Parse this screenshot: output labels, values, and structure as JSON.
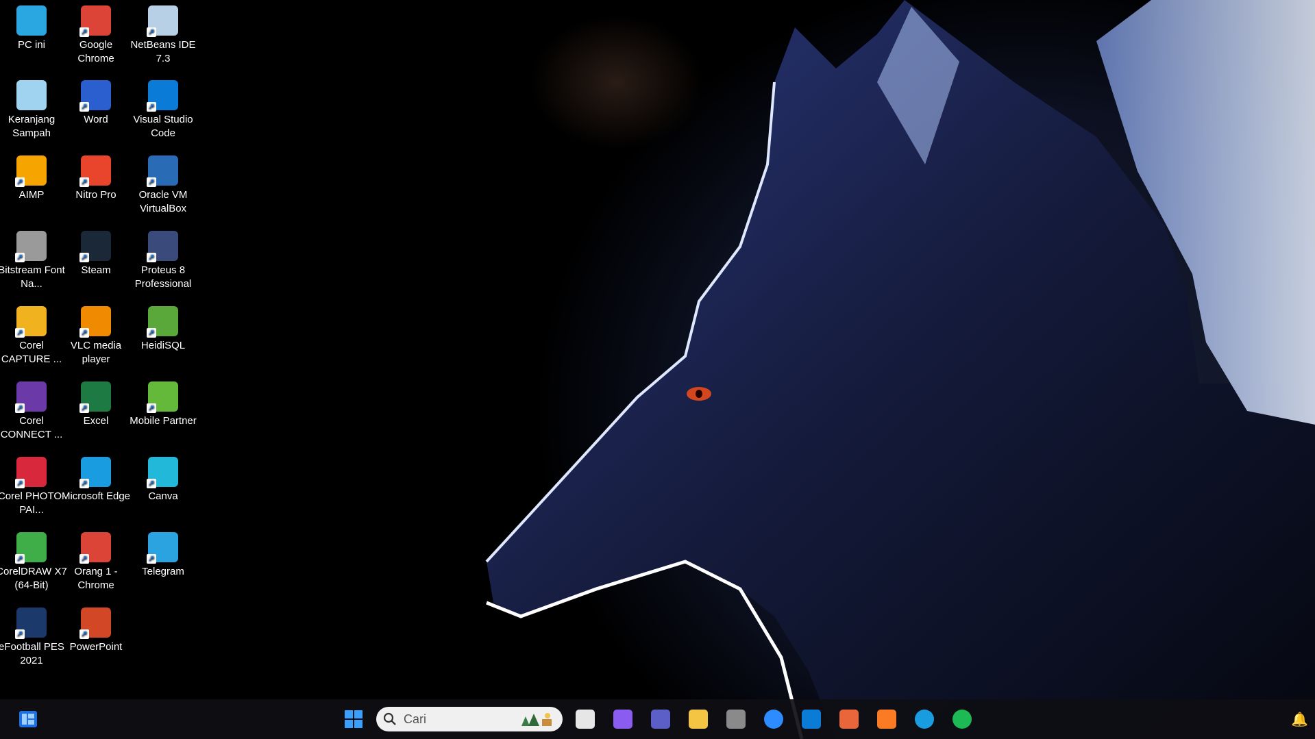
{
  "desktop": {
    "icons": [
      {
        "label": "PC ini",
        "icon": "monitor-icon",
        "color": "#2aa7e0"
      },
      {
        "label": "Keranjang Sampah",
        "icon": "recycle-bin-icon",
        "color": "#9fd3f0"
      },
      {
        "label": "AIMP",
        "icon": "aimp-icon",
        "color": "#f5a400"
      },
      {
        "label": "Bitstream Font Na...",
        "icon": "bitstream-font-icon",
        "color": "#9a9a9a"
      },
      {
        "label": "Corel CAPTURE ...",
        "icon": "corel-capture-icon",
        "color": "#f0b21e"
      },
      {
        "label": "Corel CONNECT ...",
        "icon": "corel-connect-icon",
        "color": "#6b3aa8"
      },
      {
        "label": "Corel PHOTO-PAI...",
        "icon": "corel-photopaint-icon",
        "color": "#d8283c"
      },
      {
        "label": "CorelDRAW X7 (64-Bit)",
        "icon": "coreldraw-icon",
        "color": "#3fae49"
      },
      {
        "label": "eFootball PES 2021",
        "icon": "efootball-icon",
        "color": "#1b3a6b"
      },
      {
        "label": "Google Chrome",
        "icon": "chrome-icon",
        "color": "#db4437"
      },
      {
        "label": "Word",
        "icon": "word-icon",
        "color": "#2b5fcf"
      },
      {
        "label": "Nitro Pro",
        "icon": "nitro-pro-icon",
        "color": "#e8452c"
      },
      {
        "label": "Steam",
        "icon": "steam-icon",
        "color": "#1b2838"
      },
      {
        "label": "VLC media player",
        "icon": "vlc-icon",
        "color": "#f08a00"
      },
      {
        "label": "Excel",
        "icon": "excel-icon",
        "color": "#1d7a43"
      },
      {
        "label": "Microsoft Edge",
        "icon": "edge-icon",
        "color": "#1a9de0"
      },
      {
        "label": "Orang 1 - Chrome",
        "icon": "chrome-profile-icon",
        "color": "#db4437"
      },
      {
        "label": "PowerPoint",
        "icon": "powerpoint-icon",
        "color": "#d24726"
      },
      {
        "label": "NetBeans IDE 7.3",
        "icon": "netbeans-icon",
        "color": "#b8d0e6"
      },
      {
        "label": "Visual Studio Code",
        "icon": "vscode-icon",
        "color": "#0a7bd6"
      },
      {
        "label": "Oracle VM VirtualBox",
        "icon": "virtualbox-icon",
        "color": "#2a6bb5"
      },
      {
        "label": "Proteus 8 Professional",
        "icon": "proteus-icon",
        "color": "#3a4a7a"
      },
      {
        "label": "HeidiSQL",
        "icon": "heidisql-icon",
        "color": "#5aa83a"
      },
      {
        "label": "Mobile Partner",
        "icon": "mobile-partner-icon",
        "color": "#64b83a"
      },
      {
        "label": "Canva",
        "icon": "canva-icon",
        "color": "#21b8d9"
      },
      {
        "label": "Telegram",
        "icon": "telegram-icon",
        "color": "#2aa3e0"
      }
    ]
  },
  "taskbar": {
    "widgets_icon": "widgets-icon",
    "start_icon": "windows-start-icon",
    "search": {
      "placeholder": "Cari",
      "icon": "search-icon",
      "highlight": "search-highlight-icon"
    },
    "pinned": [
      {
        "name": "task-view",
        "icon": "task-view-icon",
        "color": "#e6e6e6"
      },
      {
        "name": "copilot",
        "icon": "copilot-icon",
        "color": "#8a5cf0"
      },
      {
        "name": "teams",
        "icon": "teams-icon",
        "color": "#5b5fc7"
      },
      {
        "name": "file-explorer",
        "icon": "folder-icon",
        "color": "#f4c542"
      },
      {
        "name": "app-shield",
        "icon": "shield-app-icon",
        "color": "#8a8a8a"
      },
      {
        "name": "zoom",
        "icon": "zoom-icon",
        "color": "#2d8cff"
      },
      {
        "name": "vscode",
        "icon": "vscode-icon",
        "color": "#0a7bd6"
      },
      {
        "name": "matlab",
        "icon": "matlab-icon",
        "color": "#e8663a"
      },
      {
        "name": "xampp",
        "icon": "xampp-icon",
        "color": "#fb7a24"
      },
      {
        "name": "edge",
        "icon": "edge-icon",
        "color": "#1a9de0"
      },
      {
        "name": "spotify",
        "icon": "spotify-icon",
        "color": "#1db954"
      }
    ],
    "tray_icon": "notification-bell-icon"
  },
  "colors": {
    "accent": "#0078d4",
    "wallpaper_blue": "#2a3a7a"
  }
}
